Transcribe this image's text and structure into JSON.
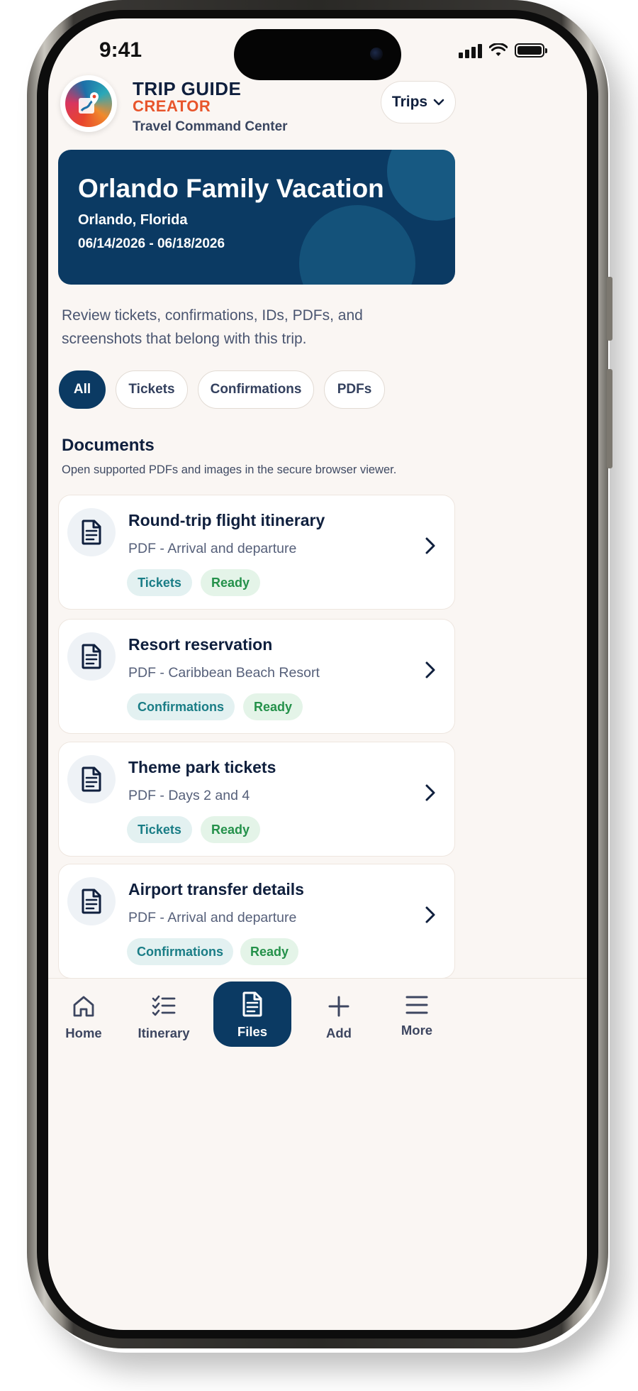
{
  "status_bar": {
    "time": "9:41"
  },
  "header": {
    "brand_line1": "TRIP GUIDE",
    "brand_line2": "CREATOR",
    "subtitle": "Travel Command Center",
    "trips_button": "Trips"
  },
  "trip": {
    "title": "Orlando Family Vacation",
    "location": "Orlando, Florida",
    "dates": "06/14/2026 - 06/18/2026"
  },
  "intro": "Review tickets, confirmations, IDs, PDFs, and screenshots that belong with this trip.",
  "filters": [
    {
      "label": "All",
      "active": true
    },
    {
      "label": "Tickets",
      "active": false
    },
    {
      "label": "Confirmations",
      "active": false
    },
    {
      "label": "PDFs",
      "active": false
    }
  ],
  "documents_section": {
    "title": "Documents",
    "subtitle": "Open supported PDFs and images in the secure browser viewer."
  },
  "documents": [
    {
      "title": "Round-trip flight itinerary",
      "subtitle": "PDF - Arrival and departure",
      "category": "Tickets",
      "status": "Ready"
    },
    {
      "title": "Resort reservation",
      "subtitle": "PDF - Caribbean Beach Resort",
      "category": "Confirmations",
      "status": "Ready"
    },
    {
      "title": "Theme park tickets",
      "subtitle": "PDF - Days 2 and 4",
      "category": "Tickets",
      "status": "Ready"
    },
    {
      "title": "Airport transfer details",
      "subtitle": "PDF - Arrival and departure",
      "category": "Confirmations",
      "status": "Ready"
    }
  ],
  "nav": [
    {
      "label": "Home",
      "icon": "home-icon"
    },
    {
      "label": "Itinerary",
      "icon": "checklist-icon"
    },
    {
      "label": "Files",
      "icon": "document-icon",
      "active": true
    },
    {
      "label": "Add",
      "icon": "plus-icon"
    },
    {
      "label": "More",
      "icon": "menu-icon"
    }
  ],
  "colors": {
    "primary": "#0b3a63",
    "accent": "#e8552c",
    "tag_category": "#1a7d86",
    "tag_ready": "#24914a",
    "background": "#faf6f3"
  }
}
